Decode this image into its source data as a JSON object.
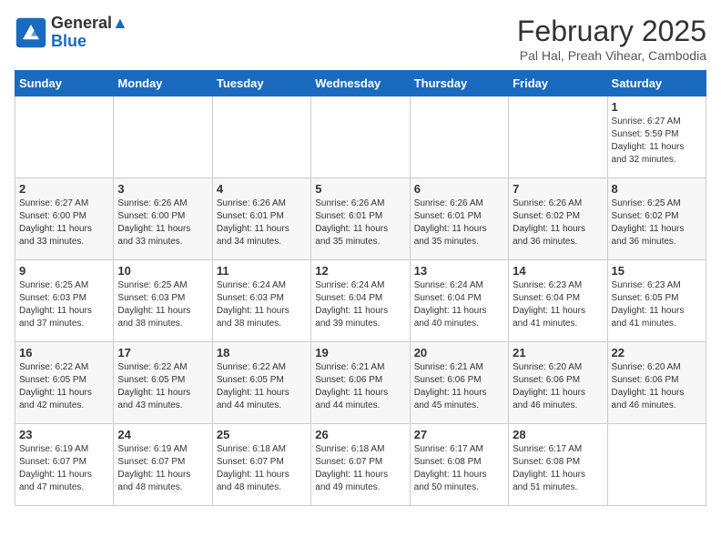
{
  "header": {
    "logo_line1": "General",
    "logo_line2": "Blue",
    "month_year": "February 2025",
    "location": "Pal Hal, Preah Vihear, Cambodia"
  },
  "days_of_week": [
    "Sunday",
    "Monday",
    "Tuesday",
    "Wednesday",
    "Thursday",
    "Friday",
    "Saturday"
  ],
  "weeks": [
    [
      {
        "day": "",
        "info": ""
      },
      {
        "day": "",
        "info": ""
      },
      {
        "day": "",
        "info": ""
      },
      {
        "day": "",
        "info": ""
      },
      {
        "day": "",
        "info": ""
      },
      {
        "day": "",
        "info": ""
      },
      {
        "day": "1",
        "info": "Sunrise: 6:27 AM\nSunset: 5:59 PM\nDaylight: 11 hours\nand 32 minutes."
      }
    ],
    [
      {
        "day": "2",
        "info": "Sunrise: 6:27 AM\nSunset: 6:00 PM\nDaylight: 11 hours\nand 33 minutes."
      },
      {
        "day": "3",
        "info": "Sunrise: 6:26 AM\nSunset: 6:00 PM\nDaylight: 11 hours\nand 33 minutes."
      },
      {
        "day": "4",
        "info": "Sunrise: 6:26 AM\nSunset: 6:01 PM\nDaylight: 11 hours\nand 34 minutes."
      },
      {
        "day": "5",
        "info": "Sunrise: 6:26 AM\nSunset: 6:01 PM\nDaylight: 11 hours\nand 35 minutes."
      },
      {
        "day": "6",
        "info": "Sunrise: 6:26 AM\nSunset: 6:01 PM\nDaylight: 11 hours\nand 35 minutes."
      },
      {
        "day": "7",
        "info": "Sunrise: 6:26 AM\nSunset: 6:02 PM\nDaylight: 11 hours\nand 36 minutes."
      },
      {
        "day": "8",
        "info": "Sunrise: 6:25 AM\nSunset: 6:02 PM\nDaylight: 11 hours\nand 36 minutes."
      }
    ],
    [
      {
        "day": "9",
        "info": "Sunrise: 6:25 AM\nSunset: 6:03 PM\nDaylight: 11 hours\nand 37 minutes."
      },
      {
        "day": "10",
        "info": "Sunrise: 6:25 AM\nSunset: 6:03 PM\nDaylight: 11 hours\nand 38 minutes."
      },
      {
        "day": "11",
        "info": "Sunrise: 6:24 AM\nSunset: 6:03 PM\nDaylight: 11 hours\nand 38 minutes."
      },
      {
        "day": "12",
        "info": "Sunrise: 6:24 AM\nSunset: 6:04 PM\nDaylight: 11 hours\nand 39 minutes."
      },
      {
        "day": "13",
        "info": "Sunrise: 6:24 AM\nSunset: 6:04 PM\nDaylight: 11 hours\nand 40 minutes."
      },
      {
        "day": "14",
        "info": "Sunrise: 6:23 AM\nSunset: 6:04 PM\nDaylight: 11 hours\nand 41 minutes."
      },
      {
        "day": "15",
        "info": "Sunrise: 6:23 AM\nSunset: 6:05 PM\nDaylight: 11 hours\nand 41 minutes."
      }
    ],
    [
      {
        "day": "16",
        "info": "Sunrise: 6:22 AM\nSunset: 6:05 PM\nDaylight: 11 hours\nand 42 minutes."
      },
      {
        "day": "17",
        "info": "Sunrise: 6:22 AM\nSunset: 6:05 PM\nDaylight: 11 hours\nand 43 minutes."
      },
      {
        "day": "18",
        "info": "Sunrise: 6:22 AM\nSunset: 6:05 PM\nDaylight: 11 hours\nand 44 minutes."
      },
      {
        "day": "19",
        "info": "Sunrise: 6:21 AM\nSunset: 6:06 PM\nDaylight: 11 hours\nand 44 minutes."
      },
      {
        "day": "20",
        "info": "Sunrise: 6:21 AM\nSunset: 6:06 PM\nDaylight: 11 hours\nand 45 minutes."
      },
      {
        "day": "21",
        "info": "Sunrise: 6:20 AM\nSunset: 6:06 PM\nDaylight: 11 hours\nand 46 minutes."
      },
      {
        "day": "22",
        "info": "Sunrise: 6:20 AM\nSunset: 6:06 PM\nDaylight: 11 hours\nand 46 minutes."
      }
    ],
    [
      {
        "day": "23",
        "info": "Sunrise: 6:19 AM\nSunset: 6:07 PM\nDaylight: 11 hours\nand 47 minutes."
      },
      {
        "day": "24",
        "info": "Sunrise: 6:19 AM\nSunset: 6:07 PM\nDaylight: 11 hours\nand 48 minutes."
      },
      {
        "day": "25",
        "info": "Sunrise: 6:18 AM\nSunset: 6:07 PM\nDaylight: 11 hours\nand 48 minutes."
      },
      {
        "day": "26",
        "info": "Sunrise: 6:18 AM\nSunset: 6:07 PM\nDaylight: 11 hours\nand 49 minutes."
      },
      {
        "day": "27",
        "info": "Sunrise: 6:17 AM\nSunset: 6:08 PM\nDaylight: 11 hours\nand 50 minutes."
      },
      {
        "day": "28",
        "info": "Sunrise: 6:17 AM\nSunset: 6:08 PM\nDaylight: 11 hours\nand 51 minutes."
      },
      {
        "day": "",
        "info": ""
      }
    ]
  ]
}
